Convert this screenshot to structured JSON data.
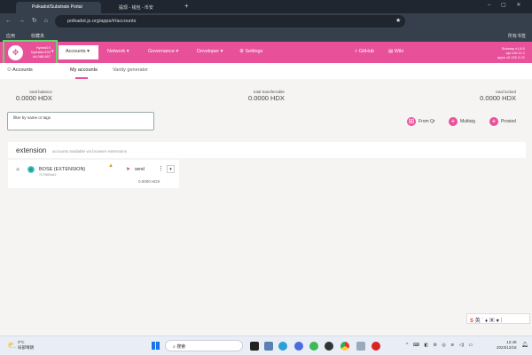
{
  "browser": {
    "tabs": [
      {
        "label": "Polkadot/Substrate Portal"
      },
      {
        "label": "提现 - 钱包 - 币安"
      }
    ],
    "url": "polkadot.js.org/apps/#/accounts",
    "bookmarks": [
      "应用",
      "收藏夹"
    ],
    "all_bookmarks": "所有书签"
  },
  "chain": {
    "name": "HydraDX",
    "spec": "hydradx/193",
    "block": "#4,068,467"
  },
  "nav": {
    "items": [
      "Accounts",
      "Network",
      "Governance",
      "Developer",
      "Settings"
    ],
    "links": [
      "GitHub",
      "Wiki"
    ],
    "version": [
      "Subway v1.8.0",
      "api v10.11.1",
      "apps v0.132.2-21"
    ]
  },
  "subnav": {
    "section": "Accounts",
    "tabs": [
      "My accounts",
      "Vanity generator"
    ]
  },
  "summary": [
    {
      "label": "total balance",
      "value": "0.0000 HDX"
    },
    {
      "label": "total transferrable",
      "value": "0.0000 HDX"
    },
    {
      "label": "total locked",
      "value": "0.0000 HDX"
    }
  ],
  "filter": {
    "placeholder": "filter by name or tags"
  },
  "actions": [
    "From Qr",
    "Multisig",
    "Proxied"
  ],
  "extension": {
    "title": "extension",
    "subtitle": "accounts available via browser extensions",
    "account": {
      "name": "BOSE (EXTENSION)",
      "address": "7LT9fUNs42",
      "send": "send",
      "balance": "0.0000 HDX"
    }
  },
  "taskbar": {
    "weather_temp": "0°C",
    "weather_desc": "局部晴朗",
    "search": "搜索",
    "time": "12:49",
    "date": "2023/12/18",
    "ime": "英"
  },
  "colors": {
    "accent": "#e8519a",
    "highlight": "#6bd36b"
  }
}
